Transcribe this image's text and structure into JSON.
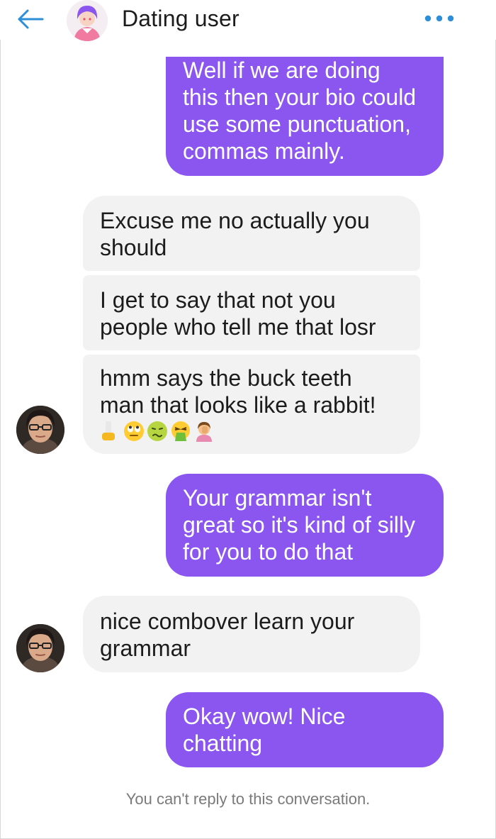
{
  "header": {
    "title": "Dating user",
    "back_icon": "arrow-left-icon",
    "menu_icon": "more-dots-icon",
    "accent": "#2d8fd6"
  },
  "colors": {
    "outgoing_bubble": "#8a56ef",
    "incoming_bubble": "#f2f2f2"
  },
  "messages": [
    {
      "direction": "outgoing",
      "text": "Well if we are doing\nthis then your bio could\nuse some punctuation,\ncommas mainly."
    },
    {
      "direction": "incoming",
      "text": "Excuse me no actually you\nshould"
    },
    {
      "direction": "incoming",
      "text": "I get to say that not you\npeople who tell me that losr"
    },
    {
      "direction": "incoming",
      "text": "hmm says the buck teeth\nman that looks like a rabbit!",
      "emojis": [
        "middle-finger-emoji",
        "eye-roll-emoji",
        "nauseated-emoji",
        "vomiting-emoji",
        "facepalm-emoji"
      ]
    },
    {
      "direction": "outgoing",
      "text": "Your grammar isn't\ngreat so it's kind of silly\nfor you to do that"
    },
    {
      "direction": "incoming",
      "text": "nice combover learn your\ngrammar"
    },
    {
      "direction": "outgoing",
      "text": "Okay wow! Nice\nchatting"
    }
  ],
  "footer": {
    "note": "You can't reply to this conversation."
  }
}
